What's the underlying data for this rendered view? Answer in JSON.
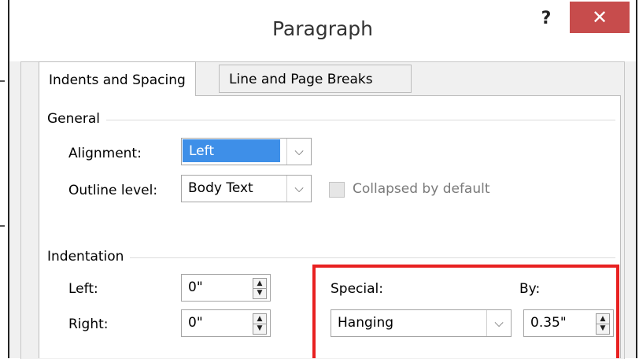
{
  "dialog": {
    "title": "Paragraph",
    "help_label": "?",
    "close_label": "✕"
  },
  "tabs": [
    {
      "label": "Indents and Spacing",
      "active": true
    },
    {
      "label": "Line and Page Breaks",
      "active": false
    }
  ],
  "general": {
    "heading": "General",
    "alignment_label": "Alignment:",
    "alignment_value": "Left",
    "outline_label": "Outline level:",
    "outline_value": "Body Text",
    "collapsed_label": "Collapsed by default"
  },
  "indentation": {
    "heading": "Indentation",
    "left_label": "Left:",
    "left_value": "0\"",
    "right_label": "Right:",
    "right_value": "0\"",
    "special_label": "Special:",
    "special_value": "Hanging",
    "by_label": "By:",
    "by_value": "0.35\""
  },
  "colors": {
    "close_button": "#c74c4c",
    "selection": "#3e8fe8",
    "highlight_box": "#e82020"
  },
  "icons": {
    "dropdown": "chevron-down-icon",
    "spin_up": "spin-up-icon",
    "spin_down": "spin-down-icon"
  }
}
